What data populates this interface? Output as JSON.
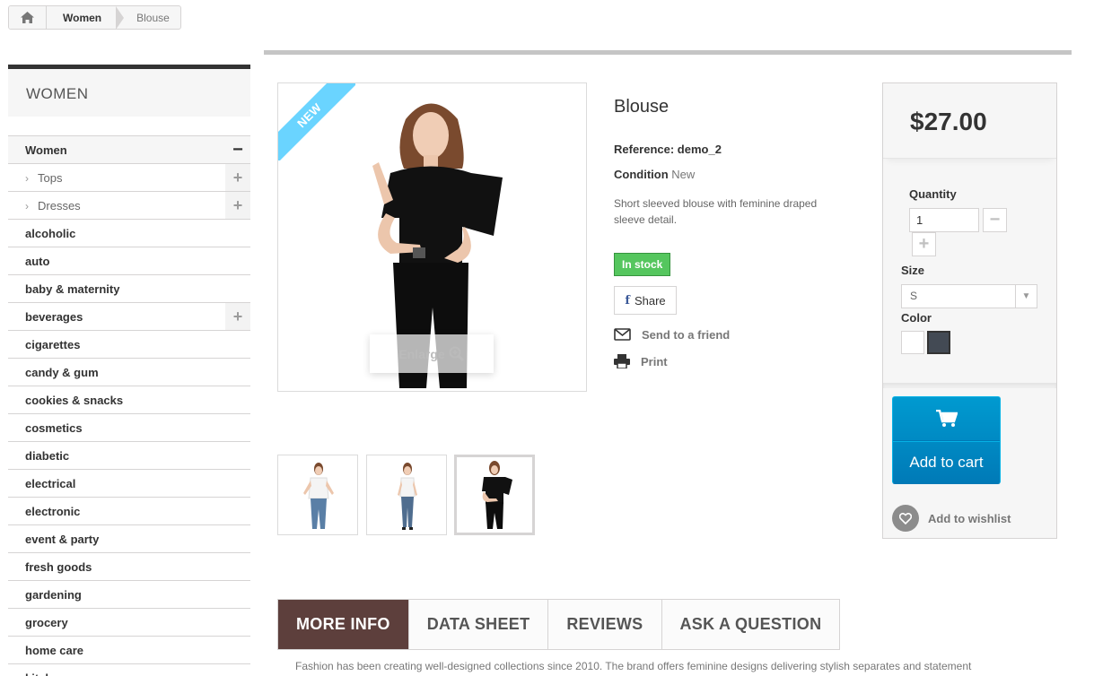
{
  "breadcrumb": {
    "items": [
      "Women",
      "Blouse"
    ]
  },
  "sidebar": {
    "title": "WOMEN",
    "categories": [
      {
        "label": "Women",
        "toggle": "−",
        "level": "top"
      },
      {
        "label": "Tops",
        "toggle": "+",
        "level": "sub"
      },
      {
        "label": "Dresses",
        "toggle": "+",
        "level": "sub"
      },
      {
        "label": "alcoholic",
        "toggle": ""
      },
      {
        "label": "auto",
        "toggle": ""
      },
      {
        "label": "baby & maternity",
        "toggle": ""
      },
      {
        "label": "beverages",
        "toggle": "+"
      },
      {
        "label": "cigarettes",
        "toggle": ""
      },
      {
        "label": "candy & gum",
        "toggle": ""
      },
      {
        "label": "cookies & snacks",
        "toggle": ""
      },
      {
        "label": "cosmetics",
        "toggle": ""
      },
      {
        "label": "diabetic",
        "toggle": ""
      },
      {
        "label": "electrical",
        "toggle": ""
      },
      {
        "label": "electronic",
        "toggle": ""
      },
      {
        "label": "event & party",
        "toggle": ""
      },
      {
        "label": "fresh goods",
        "toggle": ""
      },
      {
        "label": "gardening",
        "toggle": ""
      },
      {
        "label": "grocery",
        "toggle": ""
      },
      {
        "label": "home care",
        "toggle": ""
      },
      {
        "label": "kitchenware",
        "toggle": ""
      }
    ]
  },
  "product": {
    "badge": "NEW",
    "enlarge_label": "Enlarge",
    "name": "Blouse",
    "reference": "Reference: demo_2",
    "condition_label": "Condition",
    "condition_value": "New",
    "description": "Short sleeved blouse with feminine draped sleeve detail.",
    "stock": "In stock",
    "share_label": "Share",
    "send_friend": "Send to a friend",
    "print": "Print"
  },
  "buy": {
    "price": "$27.00",
    "quantity_label": "Quantity",
    "quantity_value": "1",
    "size_label": "Size",
    "size_value": "S",
    "color_label": "Color",
    "colors": [
      "#ffffff",
      "#434a54"
    ],
    "add_to_cart": "Add to cart",
    "wishlist": "Add to wishlist"
  },
  "tabs": [
    "MORE INFO",
    "DATA SHEET",
    "REVIEWS",
    "ASK A QUESTION"
  ],
  "more_info_text": "Fashion has been creating well-designed collections since 2010. The brand offers feminine designs delivering stylish separates and statement"
}
